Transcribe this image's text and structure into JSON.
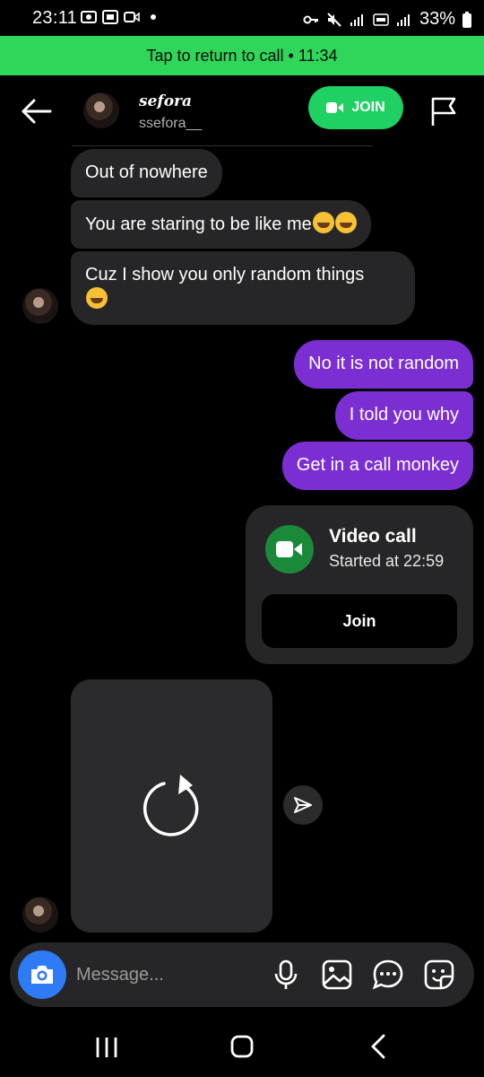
{
  "status_bar": {
    "time": "23:11",
    "battery": "33%"
  },
  "call_banner": {
    "text": "Tap to return to call • 11:34"
  },
  "header": {
    "name": "sefora",
    "handle": "ssefora__",
    "join_label": "JOIN"
  },
  "messages": {
    "incoming": [
      "Out of nowhere",
      "You are staring to be like me",
      "Cuz I show you only random things"
    ],
    "outgoing": [
      "No it is not random",
      "I told you why",
      "Get in a call monkey"
    ]
  },
  "video_call": {
    "title": "Video call",
    "subtitle": "Started at 22:59",
    "join_label": "Join"
  },
  "composer": {
    "placeholder": "Message..."
  },
  "colors": {
    "banner": "#2fd65a",
    "join_pill": "#1fd062",
    "outgoing_bubble": "#7b2fd3",
    "incoming_bubble": "#262628",
    "camera_button": "#2f7bf6"
  },
  "icons": [
    "back-arrow-icon",
    "video-camera-icon",
    "flag-icon",
    "reload-icon",
    "send-icon",
    "camera-icon",
    "microphone-icon",
    "gallery-icon",
    "chat-bubble-icon",
    "sticker-icon",
    "recents-icon",
    "home-icon",
    "nav-back-icon"
  ]
}
